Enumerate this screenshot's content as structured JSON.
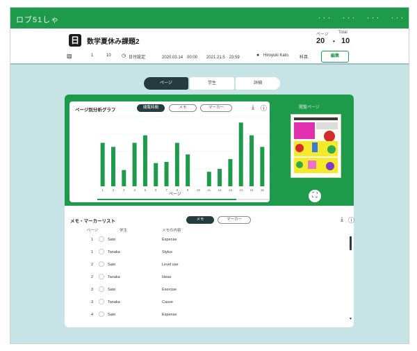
{
  "app": {
    "brand": "ロブ51しゃ",
    "nav": [
      "・・・",
      "・・・",
      "・・・",
      "・・・"
    ]
  },
  "book": {
    "icon_letter": "日",
    "title": "数学夏休み課題2",
    "page_label": "ページ",
    "page_value": "20",
    "total_label": "Total",
    "total_value": "10",
    "separator": "•"
  },
  "info": {
    "pages": "1",
    "count": "10",
    "date_label": "日付設定",
    "start": "2020.03.14　00:00",
    "end": "2021.21.5　23:59",
    "user": "Hiroyuki Kato.",
    "role": "科目.",
    "action": "編集"
  },
  "tabs": [
    "ページ",
    "学生",
    "詳細"
  ],
  "chart_card": {
    "title": "ページ別分析グラフ",
    "chips": [
      "閲覧時間",
      "メモ",
      "マーカー"
    ],
    "thumb_label": "閲覧ページ"
  },
  "chart_data": {
    "type": "bar",
    "title": "",
    "xlabel": "ページ",
    "ylabel": "",
    "categories": [
      "1",
      "2",
      "3",
      "4",
      "5",
      "6",
      "7",
      "8",
      "9",
      "10",
      "11",
      "12",
      "13",
      "14",
      "15",
      "16"
    ],
    "values": [
      7.5,
      6.8,
      2.8,
      7.5,
      8.8,
      4.0,
      4.2,
      7.5,
      5.5,
      0,
      2.5,
      3.0,
      4.7,
      11.0,
      8.8,
      6.8
    ],
    "ylim": [
      0,
      12
    ],
    "grid": true,
    "color": "#1e9b4a"
  },
  "list": {
    "title": "メモ・マーカーリスト",
    "chips": [
      "メモ",
      "マーカー"
    ],
    "headers": [
      "ページ",
      "学生",
      "メモの内容"
    ],
    "rows": [
      {
        "page": "1",
        "student": "Sato",
        "memo": "Expense"
      },
      {
        "page": "1",
        "student": "Tanaka",
        "memo": "Stylus"
      },
      {
        "page": "2",
        "student": "Sato",
        "memo": "Level use"
      },
      {
        "page": "2",
        "student": "Tanaka",
        "memo": "Ideas"
      },
      {
        "page": "3",
        "student": "Sato",
        "memo": "Exercise"
      },
      {
        "page": "3",
        "student": "Tanaka",
        "memo": "Cause"
      },
      {
        "page": "4",
        "student": "Sato",
        "memo": "Expense"
      }
    ]
  },
  "colors": {
    "accent": "#1e9b4a",
    "dark": "#243c3f",
    "background": "#c6e4e6"
  }
}
